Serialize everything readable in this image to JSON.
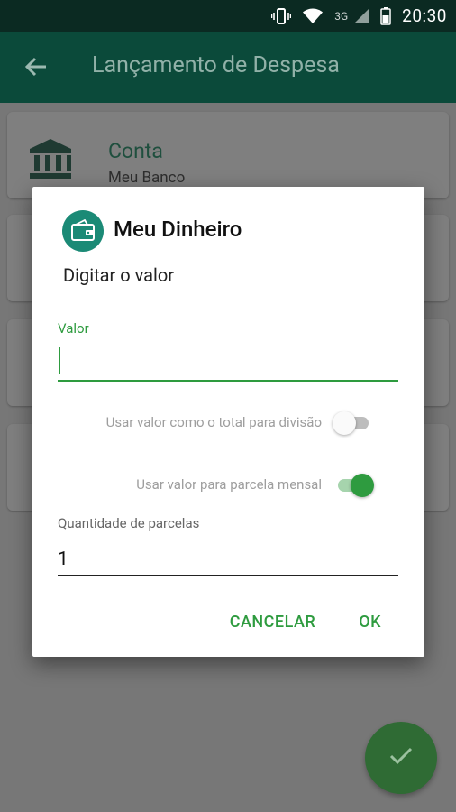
{
  "status_bar": {
    "network": "3G",
    "time": "20:30"
  },
  "app_bar": {
    "title": "Lançamento de Despesa"
  },
  "cards": {
    "account_title": "Conta",
    "account_value": "Meu Banco"
  },
  "dialog": {
    "title": "Meu Dinheiro",
    "subtitle": "Digitar o valor",
    "valor_label": "Valor",
    "valor_value": "",
    "toggle_total_label": "Usar valor como o total para divisão",
    "toggle_total_on": false,
    "toggle_parcela_label": "Usar valor para parcela mensal",
    "toggle_parcela_on": true,
    "parcelas_label": "Quantidade de parcelas",
    "parcelas_value": "1",
    "cancel_label": "CANCELAR",
    "ok_label": "OK"
  },
  "colors": {
    "accent": "#2e9b3f",
    "app_bar": "#0b4a3a",
    "status_bar": "#0b2a22"
  }
}
